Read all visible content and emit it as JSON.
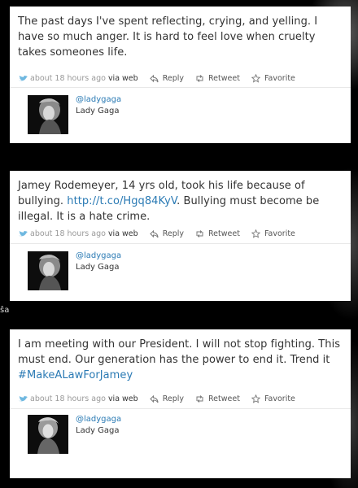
{
  "side_text": "ŝa",
  "actions": {
    "reply": "Reply",
    "retweet": "Retweet",
    "favorite": "Favorite"
  },
  "author": {
    "handle": "@ladygaga",
    "name": "Lady Gaga"
  },
  "tweets": [
    {
      "text": "The past days I've spent reflecting, crying, and yelling. I have so much anger. It is hard to feel love when cruelty takes someones life.",
      "time": "about 18 hours ago",
      "via": "via web"
    },
    {
      "text_before": "Jamey Rodemeyer, 14 yrs old, took his life because of bullying. ",
      "link": "http://t.co/Hgq84KyV",
      "text_after": ". Bullying must become be illegal. It is a hate crime.",
      "time": "about 18 hours ago",
      "via": "via web"
    },
    {
      "text_before": "I am meeting with our President. I will not stop fighting. This must end. Our generation has the power to end it. Trend it ",
      "hashtag": "#MakeALawForJamey",
      "time": "about 18 hours ago",
      "via": "via web"
    }
  ],
  "colors": {
    "link": "#2a7ab4",
    "bird": "#6fb8e0",
    "text": "#333333",
    "meta": "#999999"
  },
  "icons": [
    "twitter-bird-icon",
    "reply-icon",
    "retweet-icon",
    "favorite-star-icon"
  ]
}
